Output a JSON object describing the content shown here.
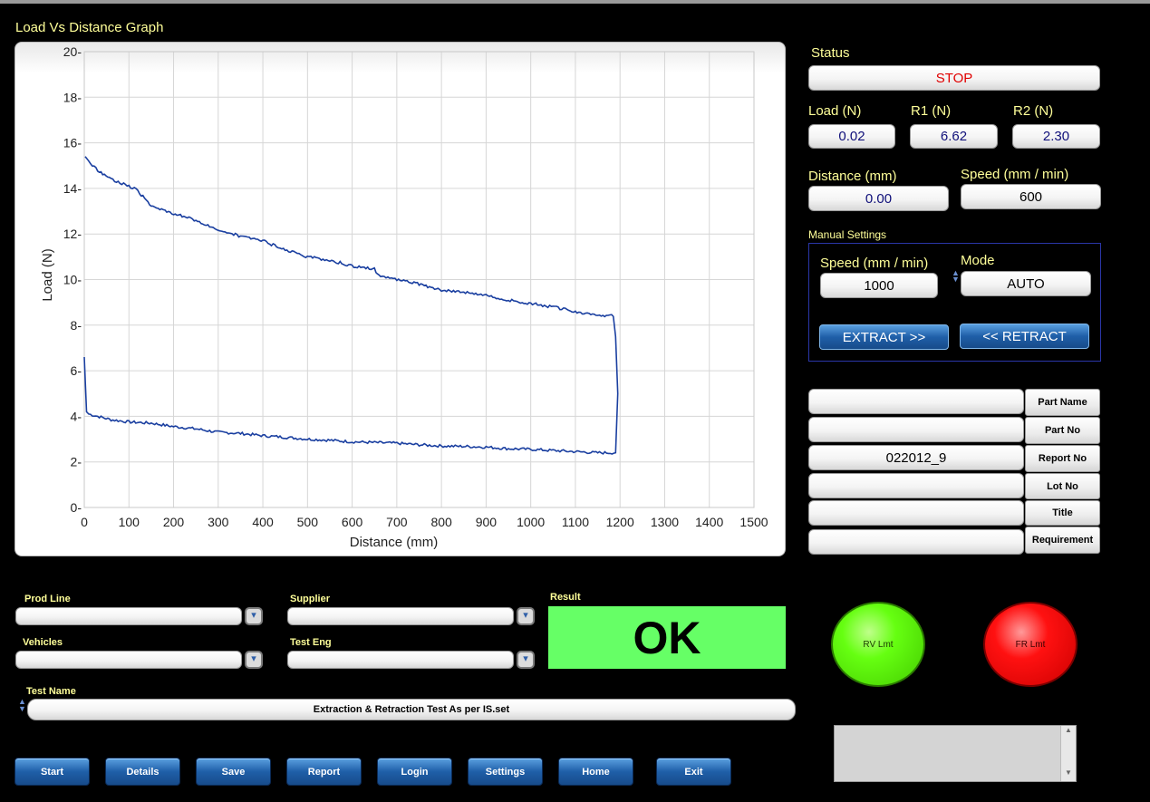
{
  "graph": {
    "title": "Load Vs Distance Graph"
  },
  "chart_data": {
    "type": "line",
    "xlabel": "Distance (mm)",
    "ylabel": "Load (N)",
    "xlim": [
      0,
      1500
    ],
    "ylim": [
      0,
      20
    ],
    "xticks": [
      0,
      100,
      200,
      300,
      400,
      500,
      600,
      700,
      800,
      900,
      1000,
      1100,
      1200,
      1300,
      1400,
      1500
    ],
    "yticks": [
      0,
      2,
      4,
      6,
      8,
      10,
      12,
      14,
      16,
      18,
      20
    ],
    "grid": true,
    "line_color": "#1a3fa0",
    "series": [
      {
        "points": [
          [
            0,
            6.6
          ],
          [
            5,
            4.2
          ],
          [
            10,
            4.1
          ],
          [
            30,
            4.0
          ],
          [
            60,
            3.85
          ],
          [
            100,
            3.75
          ],
          [
            150,
            3.7
          ],
          [
            200,
            3.55
          ],
          [
            250,
            3.45
          ],
          [
            300,
            3.3
          ],
          [
            350,
            3.25
          ],
          [
            400,
            3.15
          ],
          [
            450,
            3.08
          ],
          [
            500,
            3.0
          ],
          [
            550,
            2.95
          ],
          [
            600,
            2.88
          ],
          [
            650,
            2.85
          ],
          [
            700,
            2.82
          ],
          [
            750,
            2.75
          ],
          [
            800,
            2.7
          ],
          [
            850,
            2.68
          ],
          [
            900,
            2.65
          ],
          [
            950,
            2.58
          ],
          [
            1000,
            2.55
          ],
          [
            1050,
            2.5
          ],
          [
            1100,
            2.45
          ],
          [
            1150,
            2.4
          ],
          [
            1190,
            2.4
          ],
          [
            1195,
            5.0
          ],
          [
            1190,
            7.5
          ],
          [
            1185,
            8.4
          ],
          [
            1150,
            8.45
          ],
          [
            1100,
            8.6
          ],
          [
            1050,
            8.8
          ],
          [
            1000,
            8.95
          ],
          [
            950,
            9.1
          ],
          [
            900,
            9.3
          ],
          [
            850,
            9.45
          ],
          [
            800,
            9.55
          ],
          [
            750,
            9.8
          ],
          [
            700,
            10.0
          ],
          [
            660,
            10.2
          ],
          [
            650,
            10.45
          ],
          [
            600,
            10.6
          ],
          [
            550,
            10.85
          ],
          [
            500,
            11.0
          ],
          [
            450,
            11.3
          ],
          [
            400,
            11.7
          ],
          [
            350,
            11.9
          ],
          [
            300,
            12.2
          ],
          [
            250,
            12.6
          ],
          [
            200,
            12.9
          ],
          [
            150,
            13.2
          ],
          [
            120,
            13.9
          ],
          [
            100,
            14.1
          ],
          [
            60,
            14.4
          ],
          [
            30,
            14.8
          ],
          [
            10,
            15.2
          ],
          [
            2,
            15.4
          ]
        ]
      }
    ]
  },
  "status": {
    "label": "Status",
    "value": "STOP",
    "value_color": "#e00000"
  },
  "readouts": {
    "load_label": "Load (N)",
    "load_value": "0.02",
    "r1_label": "R1 (N)",
    "r1_value": "6.62",
    "r2_label": "R2 (N)",
    "r2_value": "2.30",
    "distance_label": "Distance (mm)",
    "distance_value": "0.00",
    "speed_label": "Speed (mm / min)",
    "speed_value": "600"
  },
  "manual": {
    "title": "Manual  Settings",
    "speed_label": "Speed (mm / min)",
    "speed_value": "1000",
    "mode_label": "Mode",
    "mode_value": "AUTO",
    "extract_label": "EXTRACT >>",
    "retract_label": "<< RETRACT"
  },
  "info_fields": [
    {
      "label": "Part Name",
      "value": ""
    },
    {
      "label": "Part No",
      "value": ""
    },
    {
      "label": "Report No",
      "value": "022012_9"
    },
    {
      "label": "Lot No",
      "value": ""
    },
    {
      "label": "Title",
      "value": ""
    },
    {
      "label": "Requirement",
      "value": ""
    }
  ],
  "form": {
    "prod_line_label": "Prod Line",
    "prod_line_value": "",
    "supplier_label": "Supplier",
    "supplier_value": "",
    "vehicles_label": "Vehicles",
    "vehicles_value": "",
    "test_eng_label": "Test Eng",
    "test_eng_value": "",
    "test_name_label": "Test Name",
    "test_name_value": "Extraction & Retraction Test As per IS.set"
  },
  "result": {
    "label": "Result",
    "value": "OK",
    "color": "#66ff66"
  },
  "limits": {
    "rv_label": "RV Lmt",
    "rv_color": "#55ee11",
    "fr_label": "FR Lmt",
    "fr_color": "#ff1111"
  },
  "buttons": {
    "start": "Start",
    "details": "Details",
    "save": "Save",
    "report": "Report",
    "login": "Login",
    "settings": "Settings",
    "home": "Home",
    "exit": "Exit"
  }
}
